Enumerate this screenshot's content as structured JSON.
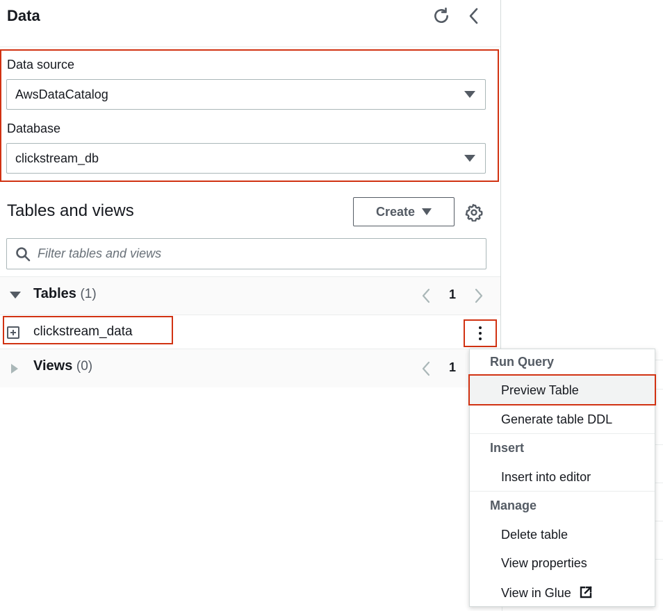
{
  "panel": {
    "title": "Data",
    "data_source": {
      "label": "Data source",
      "value": "AwsDataCatalog"
    },
    "database": {
      "label": "Database",
      "value": "clickstream_db"
    },
    "tables_and_views": {
      "title": "Tables and views",
      "create_label": "Create",
      "filter_placeholder": "Filter tables and views",
      "tables": {
        "name": "Tables",
        "count": "(1)",
        "page": "1",
        "items": [
          {
            "name": "clickstream_data"
          }
        ]
      },
      "views": {
        "name": "Views",
        "count": "(0)",
        "page": "1"
      }
    }
  },
  "icons": {
    "refresh": "refresh-icon",
    "collapse": "chevron-left-icon",
    "settings": "gear-icon",
    "search": "search-icon",
    "expand_table": "plus-square-icon",
    "actions": "kebab-menu-icon",
    "external": "external-link-icon"
  },
  "context_menu": {
    "run_query": {
      "heading": "Run Query",
      "items": [
        "Preview Table",
        "Generate table DDL"
      ]
    },
    "insert": {
      "heading": "Insert",
      "items": [
        "Insert into editor"
      ]
    },
    "manage": {
      "heading": "Manage",
      "items": [
        "Delete table",
        "View properties",
        "View in Glue"
      ]
    },
    "selected_item": "Preview Table"
  },
  "colors": {
    "highlight": "#d13212",
    "text": "#16191f",
    "muted": "#545b64",
    "border": "#aab7b8"
  }
}
